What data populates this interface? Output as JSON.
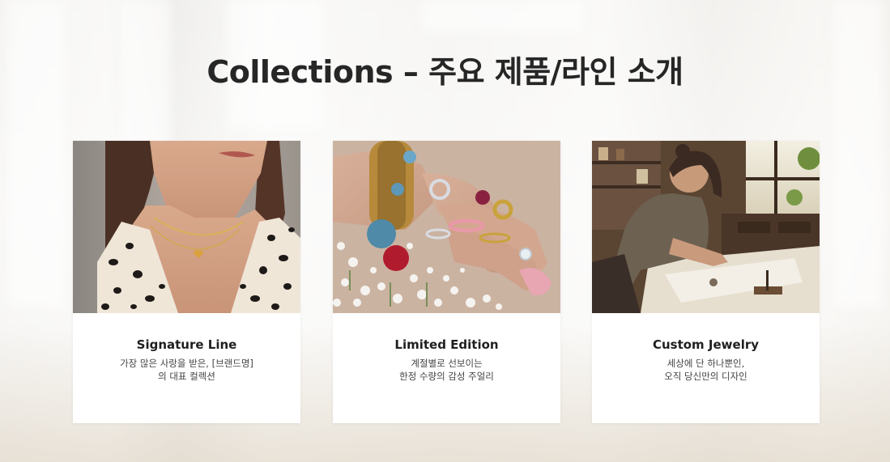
{
  "slide": {
    "title": "Collections – 주요 제품/라인 소개"
  },
  "cards": [
    {
      "title": "Signature Line",
      "desc_line1": "가장 많은 사랑을 받은, [브랜드명]",
      "desc_line2": "의 대표 컬렉션",
      "image": "necklace-model-photo"
    },
    {
      "title": "Limited Edition",
      "desc_line1": "계절별로 선보이는",
      "desc_line2": "한정 수량의 감성 주얼리",
      "image": "rings-and-flowers-photo"
    },
    {
      "title": "Custom Jewelry",
      "desc_line1": "세상에 단 하나뿐인,",
      "desc_line2": "오직 당신만의 디자인",
      "image": "jeweler-workshop-photo"
    }
  ]
}
